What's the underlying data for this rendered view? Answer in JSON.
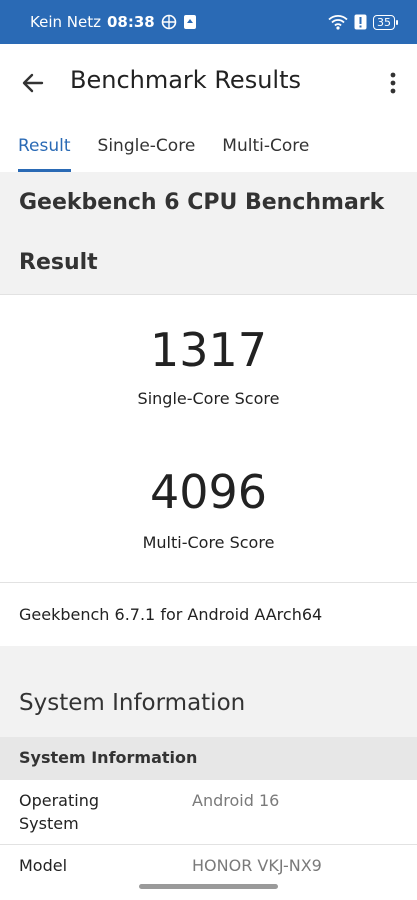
{
  "status_bar": {
    "carrier": "Kein Netz",
    "time": "08:38",
    "battery": "35"
  },
  "app_bar": {
    "title": "Benchmark Results"
  },
  "tabs": [
    {
      "label": "Result",
      "active": true
    },
    {
      "label": "Single-Core",
      "active": false
    },
    {
      "label": "Multi-Core",
      "active": false
    }
  ],
  "benchmark": {
    "title": "Geekbench 6 CPU Benchmark",
    "result_heading": "Result",
    "single_core_score": "1317",
    "single_core_label": "Single-Core Score",
    "multi_core_score": "4096",
    "multi_core_label": "Multi-Core Score",
    "version_text": "Geekbench 6.7.1 for Android AArch64"
  },
  "system_information": {
    "section_title": "System Information",
    "table_header": "System Information",
    "rows": [
      {
        "label": "Operating System",
        "value": "Android 16"
      },
      {
        "label": "Model",
        "value": "HONOR VKJ-NX9"
      }
    ]
  },
  "colors": {
    "accent": "#2a6ab5",
    "status_bar": "#2a6ab5",
    "section_bg": "#f2f2f2"
  }
}
